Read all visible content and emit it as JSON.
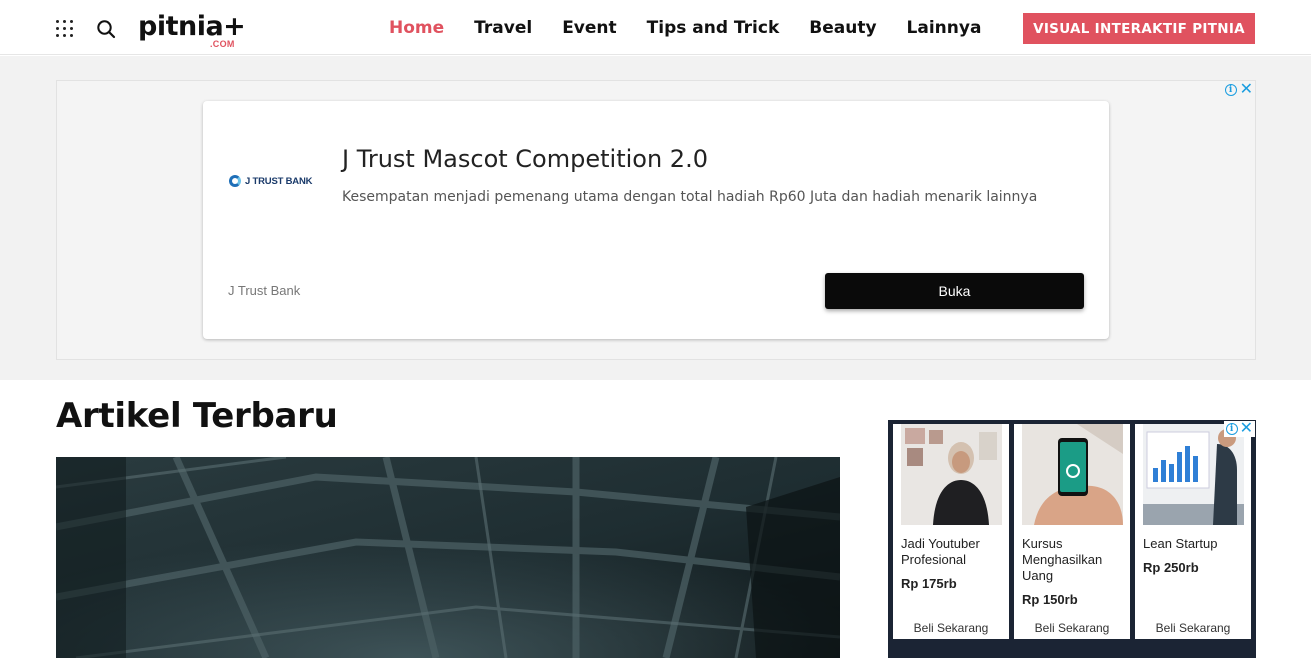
{
  "header": {
    "logo_main": "pitnia+",
    "logo_sub": ".COM",
    "nav": [
      {
        "label": "Home",
        "active": true
      },
      {
        "label": "Travel",
        "active": false
      },
      {
        "label": "Event",
        "active": false
      },
      {
        "label": "Tips and Trick",
        "active": false
      },
      {
        "label": "Beauty",
        "active": false
      },
      {
        "label": "Lainnya",
        "active": false
      }
    ],
    "cta_label": "VISUAL INTERAKTIF PITNIA"
  },
  "top_ad": {
    "brand_logo_text": "J TRUST BANK",
    "title": "J Trust Mascot Competition 2.0",
    "description": "Kesempatan menjadi pemenang utama dengan total hadiah Rp60 Juta dan hadiah menarik lainnya",
    "advertiser": "J Trust Bank",
    "button_label": "Buka",
    "info_symbol": "i",
    "close_symbol": "✕"
  },
  "main": {
    "section_title": "Artikel Terbaru"
  },
  "side_ad": {
    "info_symbol": "i",
    "close_symbol": "✕",
    "products": [
      {
        "name": "Jadi Youtuber Profesional",
        "price": "Rp 175rb",
        "buy_label": "Beli Sekarang"
      },
      {
        "name": "Kursus Menghasilkan Uang",
        "price": "Rp 150rb",
        "buy_label": "Beli Sekarang"
      },
      {
        "name": "Lean Startup",
        "price": "Rp 250rb",
        "buy_label": "Beli Sekarang"
      }
    ]
  },
  "colors": {
    "accent": "#e0525f",
    "ad_button": "#0a0a0a",
    "side_ad_bg": "#1b2434"
  }
}
